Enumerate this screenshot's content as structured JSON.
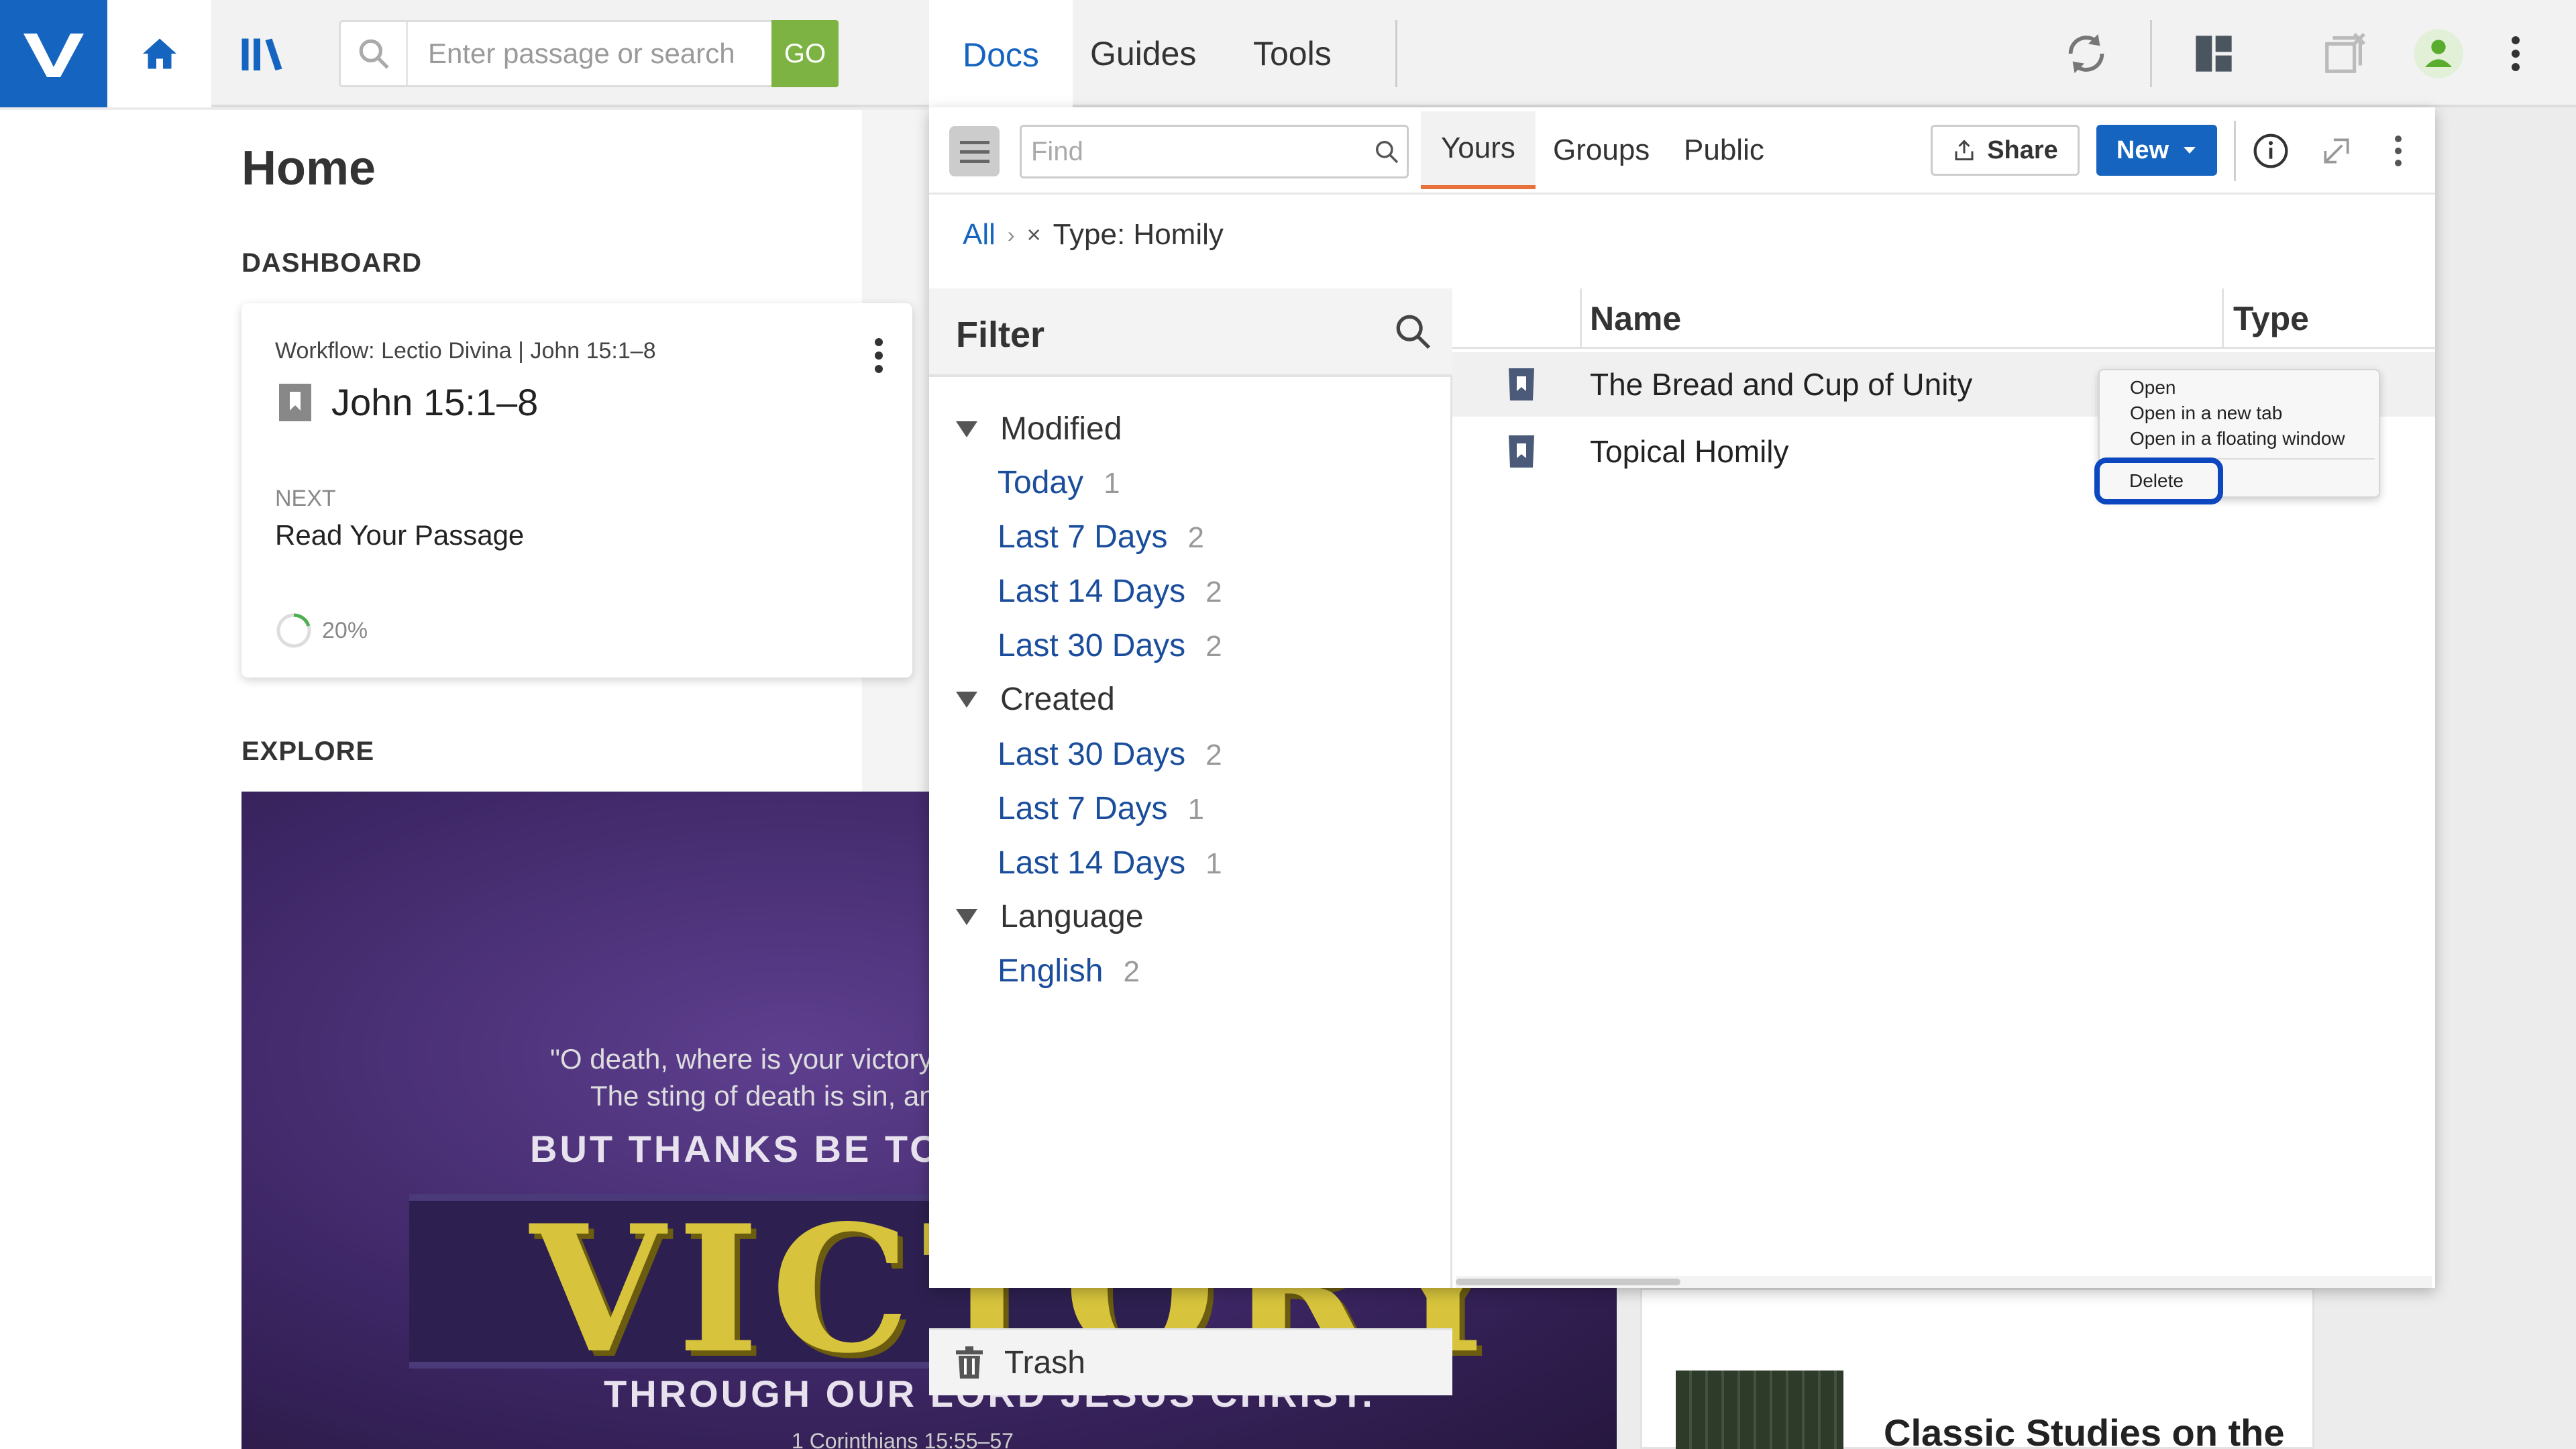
{
  "app": {
    "search_placeholder": "Enter passage or search",
    "go_label": "GO"
  },
  "home": {
    "title": "Home",
    "dashboard_label": "DASHBOARD",
    "workflow_line": "Workflow: Lectio Divina | John 15:1–8",
    "passage": "John 15:1–8",
    "next_label": "NEXT",
    "next_value": "Read Your Passage",
    "progress_text": "20%",
    "progress_value": 0.2,
    "explore_label": "EXPLORE",
    "explore_quote1": "\"O death, where is your victory?",
    "explore_quote2": "The sting of death is sin, and",
    "explore_thanks": "BUT THANKS BE TO GO",
    "explore_big": "VICTORY",
    "explore_through": "THROUGH OUR LORD JESUS CHRIST.",
    "explore_ref": "1 Corinthians 15:55–57",
    "classic_title": "Classic Studies on the"
  },
  "panel_tabs": [
    "Docs",
    "Guides",
    "Tools"
  ],
  "docs": {
    "find_placeholder": "Find",
    "scope_tabs": [
      "Yours",
      "Groups",
      "Public"
    ],
    "active_scope": "Yours",
    "share_label": "Share",
    "new_label": "New",
    "breadcrumb_all": "All",
    "breadcrumb_filter": "Type: Homily",
    "filter_title": "Filter",
    "filters": {
      "modified_label": "Modified",
      "modified": [
        {
          "label": "Today",
          "count": "1"
        },
        {
          "label": "Last 7 Days",
          "count": "2"
        },
        {
          "label": "Last 14 Days",
          "count": "2"
        },
        {
          "label": "Last 30 Days",
          "count": "2"
        }
      ],
      "created_label": "Created",
      "created": [
        {
          "label": "Last 30 Days",
          "count": "2"
        },
        {
          "label": "Last 7 Days",
          "count": "1"
        },
        {
          "label": "Last 14 Days",
          "count": "1"
        }
      ],
      "language_label": "Language",
      "language": [
        {
          "label": "English",
          "count": "2"
        }
      ]
    },
    "trash_label": "Trash",
    "columns": {
      "name": "Name",
      "type": "Type"
    },
    "rows": [
      {
        "name": "The Bread and Cup of Unity"
      },
      {
        "name": "Topical Homily"
      }
    ],
    "context_menu": {
      "open": "Open",
      "open_new_tab": "Open in a new tab",
      "open_floating": "Open in a floating window",
      "delete": "Delete"
    }
  },
  "colors": {
    "brand_blue": "#1565c0",
    "go_green": "#7cb342",
    "active_tab_underline": "#e8723a",
    "filter_link": "#1a4d9c",
    "delete_highlight": "#0d47c0"
  }
}
